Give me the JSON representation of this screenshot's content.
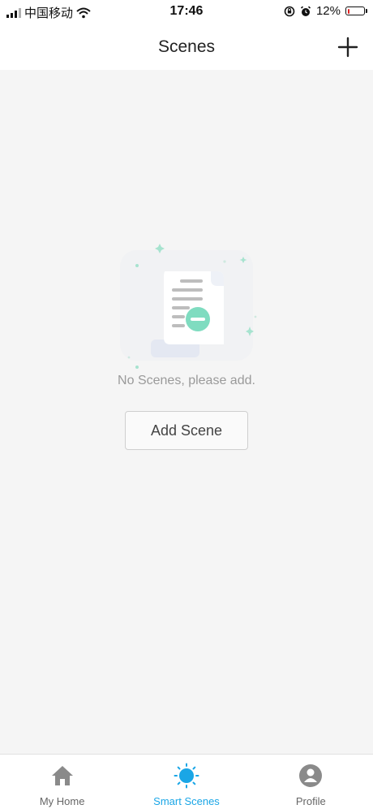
{
  "status_bar": {
    "carrier": "中国移动",
    "time": "17:46",
    "battery": "12%",
    "battery_level": 0.12
  },
  "header": {
    "title": "Scenes",
    "add_icon": "plus-icon"
  },
  "empty_state": {
    "message": "No Scenes, please add.",
    "button_label": "Add Scene",
    "illustration": "empty-document-illustration"
  },
  "tab_bar": {
    "tabs": [
      {
        "label": "My Home",
        "icon": "home-icon",
        "active": false
      },
      {
        "label": "Smart Scenes",
        "icon": "sun-icon",
        "active": true
      },
      {
        "label": "Profile",
        "icon": "profile-icon",
        "active": false
      }
    ]
  },
  "colors": {
    "accent": "#1aa6e6",
    "illustration_green": "#7fdcc0",
    "battery_low": "#e02020"
  }
}
